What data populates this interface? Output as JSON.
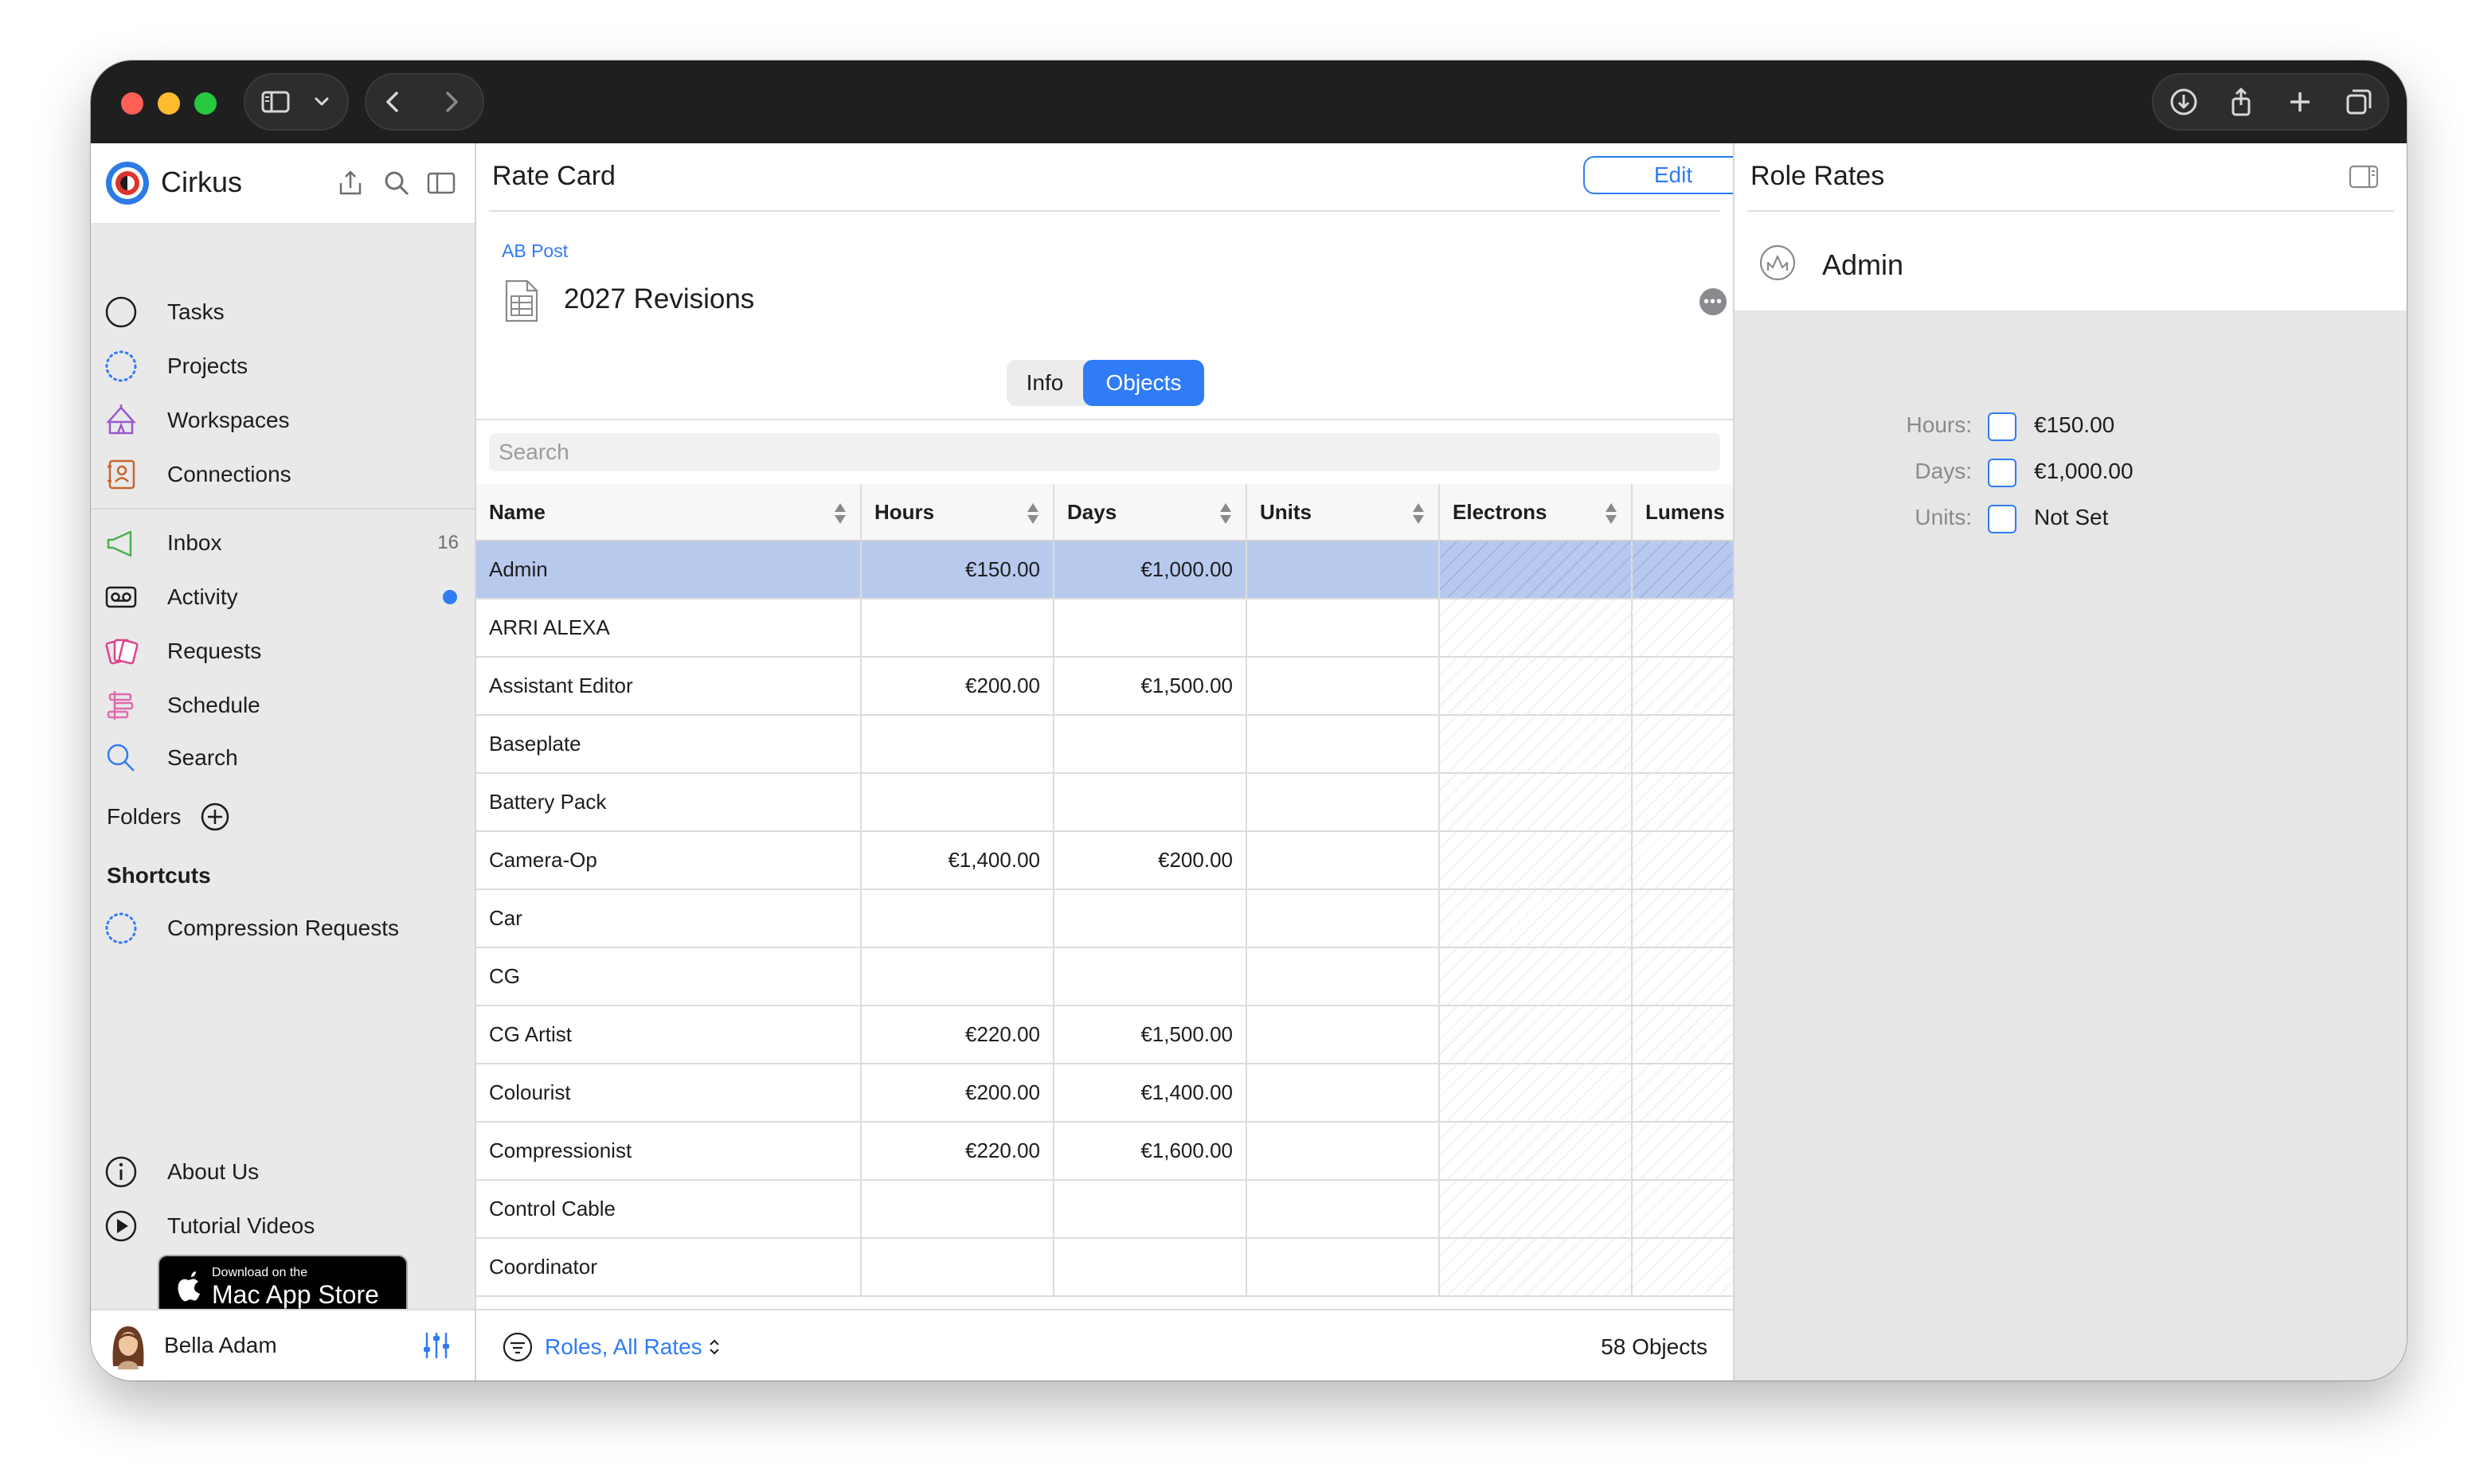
{
  "sidebar": {
    "app_name": "Cirkus",
    "nav": [
      {
        "label": "Tasks",
        "icon": "circle-icon"
      },
      {
        "label": "Projects",
        "icon": "dotted-circle-icon"
      },
      {
        "label": "Workspaces",
        "icon": "tent-icon"
      },
      {
        "label": "Connections",
        "icon": "contacts-icon"
      }
    ],
    "inbox": {
      "label": "Inbox",
      "count": "16"
    },
    "activity": {
      "label": "Activity"
    },
    "requests": {
      "label": "Requests"
    },
    "schedule": {
      "label": "Schedule"
    },
    "search": {
      "label": "Search"
    },
    "folders_label": "Folders",
    "shortcuts_label": "Shortcuts",
    "shortcut_items": [
      {
        "label": "Compression Requests"
      }
    ],
    "about": {
      "label": "About Us"
    },
    "tutorials": {
      "label": "Tutorial Videos"
    },
    "appstore": {
      "line1": "Download on the",
      "line2": "Mac App Store"
    },
    "user": {
      "name": "Bella Adam"
    }
  },
  "center": {
    "title": "Rate Card",
    "edit_label": "Edit",
    "breadcrumb": "AB Post",
    "doc_title": "2027 Revisions",
    "tabs": [
      {
        "label": "Info",
        "active": false
      },
      {
        "label": "Objects",
        "active": true
      }
    ],
    "search_placeholder": "Search",
    "columns": [
      "Name",
      "Hours",
      "Days",
      "Units",
      "Electrons",
      "Lumens"
    ],
    "rows": [
      {
        "name": "Admin",
        "hours": "€150.00",
        "days": "€1,000.00",
        "units": "",
        "selected": true
      },
      {
        "name": "ARRI ALEXA",
        "hours": "",
        "days": "",
        "units": ""
      },
      {
        "name": "Assistant Editor",
        "hours": "€200.00",
        "days": "€1,500.00",
        "units": ""
      },
      {
        "name": "Baseplate",
        "hours": "",
        "days": "",
        "units": ""
      },
      {
        "name": "Battery Pack",
        "hours": "",
        "days": "",
        "units": ""
      },
      {
        "name": "Camera-Op",
        "hours": "€1,400.00",
        "days": "€200.00",
        "units": ""
      },
      {
        "name": "Car",
        "hours": "",
        "days": "",
        "units": ""
      },
      {
        "name": "CG",
        "hours": "",
        "days": "",
        "units": ""
      },
      {
        "name": "CG Artist",
        "hours": "€220.00",
        "days": "€1,500.00",
        "units": ""
      },
      {
        "name": "Colourist",
        "hours": "€200.00",
        "days": "€1,400.00",
        "units": ""
      },
      {
        "name": "Compressionist",
        "hours": "€220.00",
        "days": "€1,600.00",
        "units": ""
      },
      {
        "name": "Control Cable",
        "hours": "",
        "days": "",
        "units": ""
      },
      {
        "name": "Coordinator",
        "hours": "",
        "days": "",
        "units": ""
      }
    ],
    "footer": {
      "filter_label": "Roles, All Rates",
      "count_label": "58 Objects"
    }
  },
  "right": {
    "title": "Role Rates",
    "role": "Admin",
    "rates": [
      {
        "label": "Hours:",
        "value": "€150.00"
      },
      {
        "label": "Days:",
        "value": "€1,000.00"
      },
      {
        "label": "Units:",
        "value": "Not Set"
      }
    ]
  },
  "colors": {
    "accent": "#2f7cf6",
    "selection": "#b8c9ee",
    "titlebar": "#1f1f1f"
  }
}
